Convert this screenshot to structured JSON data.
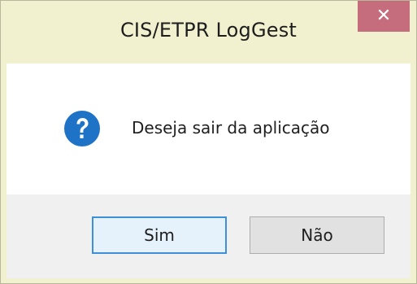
{
  "window": {
    "title": "CIS/ETPR LogGest",
    "close_glyph": "✕"
  },
  "dialog": {
    "icon": "question-icon",
    "message": "Deseja sair da aplicação",
    "buttons": {
      "yes_label": "Sim",
      "no_label": "Não"
    }
  },
  "colors": {
    "title_bar": "#f2f1cf",
    "close_button": "#c66d7d",
    "question_icon": "#1f73c7",
    "default_button_border": "#3c8fd8"
  }
}
